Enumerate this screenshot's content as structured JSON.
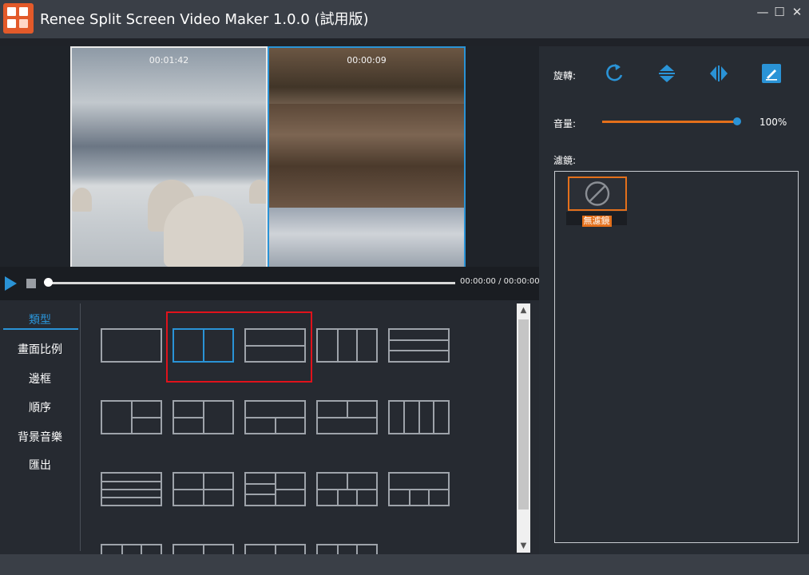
{
  "app": {
    "title": "Renee Split Screen Video Maker 1.0.0 (試用版)"
  },
  "window_controls": {
    "minimize": "—",
    "maximize": "☐",
    "close": "✕"
  },
  "preview": {
    "video1_time": "00:01:42",
    "video2_time": "00:00:09"
  },
  "player": {
    "time": "00:00:00 / 00:00:00",
    "progress": 0
  },
  "nav": {
    "items": [
      {
        "label": "類型"
      },
      {
        "label": "畫面比例"
      },
      {
        "label": "邊框"
      },
      {
        "label": "順序"
      },
      {
        "label": "背景音樂"
      },
      {
        "label": "匯出"
      }
    ],
    "active_index": 0
  },
  "templates": {
    "selected_index": 1,
    "count": 19
  },
  "right": {
    "rotate_label": "旋轉:",
    "volume_label": "音量:",
    "volume_value": "100%",
    "volume_level": 1.0,
    "filter_label": "濾鏡:",
    "filters": [
      {
        "label": "無濾鏡"
      }
    ]
  },
  "colors": {
    "accent": "#2a93d6",
    "orange": "#e4701b",
    "highlight": "#e0121b"
  }
}
